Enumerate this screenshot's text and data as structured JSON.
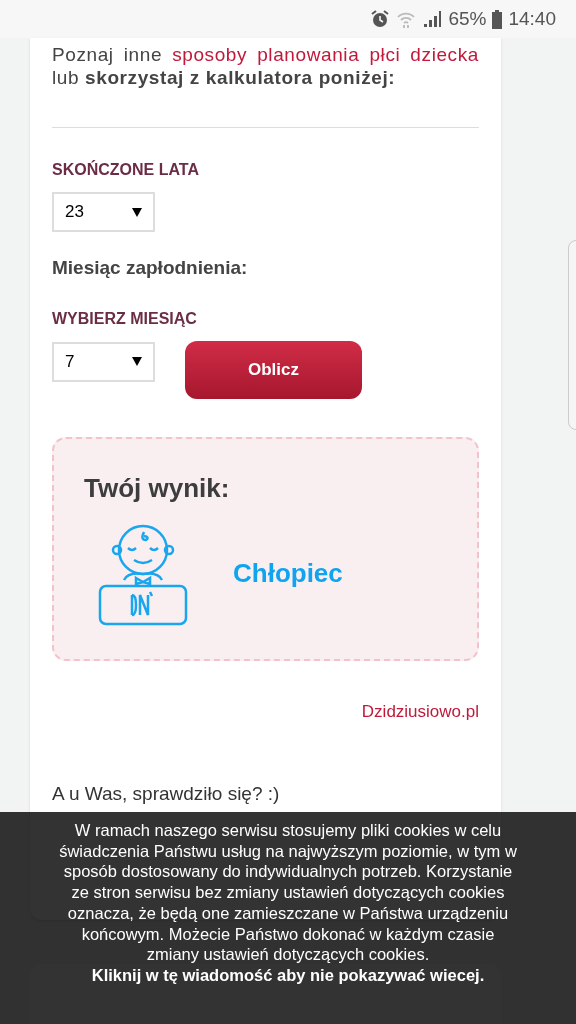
{
  "status_bar": {
    "battery": "65%",
    "time": "14:40"
  },
  "intro": {
    "text_before": "Poznaj inne",
    "link": "sposoby planowania płci dziecka",
    "text_after": "lub **skorzystaj z kalkulatora poniżej:**"
  },
  "age": {
    "label": "SKOŃCZONE LATA",
    "value": "23"
  },
  "month_heading": "Miesiąc zapłodnienia:",
  "month": {
    "label": "WYBIERZ MIESIĄC",
    "value": "7"
  },
  "button": "Oblicz",
  "result": {
    "title": "Twój wynik:",
    "value": "Chłopiec"
  },
  "source_link": "Dzidziusiowo.pl",
  "question": "A u Was, sprawdziło się? :)",
  "cookie_banner": {
    "text": "W ramach naszego serwisu stosujemy pliki cookies w celu świadczenia Państwu usług na najwyższym poziomie, w tym w sposób dostosowany do indywidualnych potrzeb. Korzystanie ze stron serwisu bez zmiany ustawień dotyczących cookies oznacza, że będą one zamieszczane w Państwa urządzeniu końcowym. Możecie Państwo dokonać w każdym czasie zmiany ustawień dotyczących cookies.",
    "dismiss": "Kliknij w tę wiadomość aby nie pokazywać wiecej."
  }
}
